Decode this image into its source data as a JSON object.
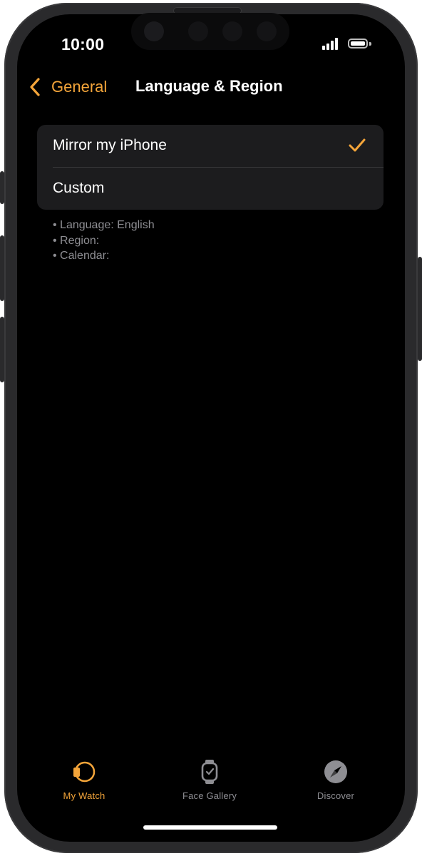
{
  "status_bar": {
    "time": "10:00"
  },
  "nav": {
    "back_label": "General",
    "title": "Language & Region"
  },
  "options": [
    {
      "label": "Mirror my iPhone",
      "selected": true
    },
    {
      "label": "Custom",
      "selected": false
    }
  ],
  "details": [
    "• Language: English",
    "• Region:",
    "• Calendar:"
  ],
  "tabs": [
    {
      "label": "My Watch",
      "icon": "watch-icon",
      "active": true
    },
    {
      "label": "Face Gallery",
      "icon": "watch-face-icon",
      "active": false
    },
    {
      "label": "Discover",
      "icon": "compass-icon",
      "active": false
    }
  ],
  "colors": {
    "accent": "#f4a53a",
    "background": "#000000",
    "group_background": "#1c1c1e",
    "secondary_text": "#8e8e93",
    "inactive_tab": "#8e8e93"
  }
}
